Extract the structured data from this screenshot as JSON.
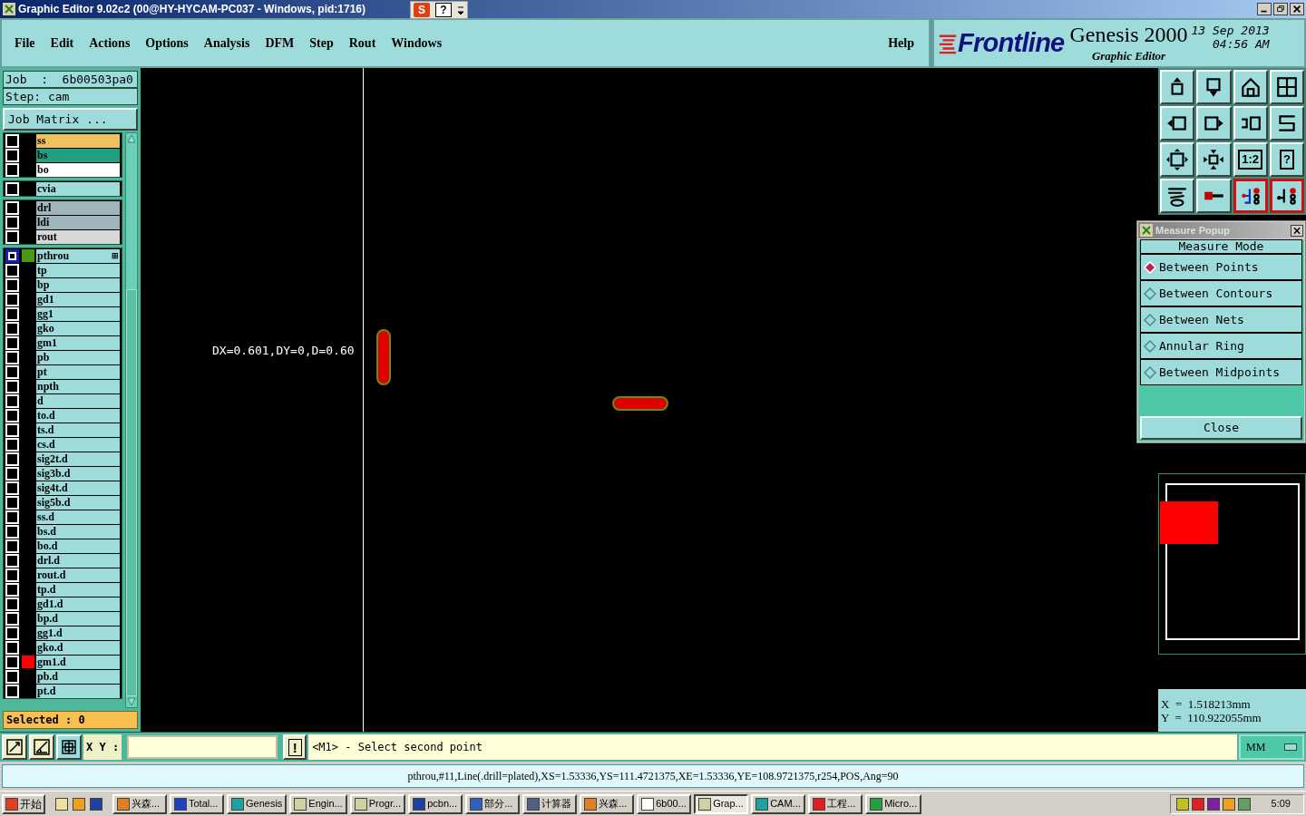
{
  "window": {
    "title": "Graphic Editor 9.02c2 (00@HY-HYCAM-PC037 - Windows, pid:1716)",
    "ime_buttons": [
      {
        "kind": "s",
        "label": "S"
      },
      {
        "kind": "help",
        "label": "?"
      }
    ]
  },
  "menu": [
    {
      "label": "File"
    },
    {
      "label": "Edit"
    },
    {
      "label": "Actions"
    },
    {
      "label": "Options"
    },
    {
      "label": "Analysis"
    },
    {
      "label": "DFM"
    },
    {
      "label": "Step"
    },
    {
      "label": "Rout"
    },
    {
      "label": "Windows"
    }
  ],
  "help_menu": "Help",
  "brand": {
    "logo": "Frontline",
    "product": "Genesis 2000",
    "subtitle": "Graphic Editor",
    "date": "13 Sep 2013",
    "time": "04:56 AM"
  },
  "job": {
    "job_label": "Job  :  6b00503pa0",
    "step_label": "Step: cam",
    "matrix_button": "Job Matrix ..."
  },
  "layer_groups": [
    {
      "layers": [
        {
          "name": "ss",
          "color": "#f0c060",
          "selected": false
        },
        {
          "name": "bs",
          "color": "#20a080",
          "selected": false
        },
        {
          "name": "bo",
          "color": "#ffffff",
          "selected": false
        }
      ]
    },
    {
      "layers": [
        {
          "name": "cvia",
          "color": "#9edcdc",
          "selected": false
        }
      ]
    },
    {
      "layers": [
        {
          "name": "drl",
          "color": "#a0b4bc",
          "selected": false
        },
        {
          "name": "ldi",
          "color": "#a0b4bc",
          "selected": false
        },
        {
          "name": "rout",
          "color": "#d8d8d8",
          "selected": false
        }
      ]
    },
    {
      "layers": [
        {
          "name": "pthrou",
          "color": "#9edcdc",
          "selected": true,
          "swatch": {
            "color": "#4a9a10"
          },
          "expand": "⊞"
        },
        {
          "name": "tp",
          "color": "#9edcdc",
          "selected": false
        },
        {
          "name": "bp",
          "color": "#9edcdc",
          "selected": false
        },
        {
          "name": "gd1",
          "color": "#9edcdc",
          "selected": false
        },
        {
          "name": "gg1",
          "color": "#9edcdc",
          "selected": false
        },
        {
          "name": "gko",
          "color": "#9edcdc",
          "selected": false
        },
        {
          "name": "gm1",
          "color": "#9edcdc",
          "selected": false
        },
        {
          "name": "pb",
          "color": "#9edcdc",
          "selected": false
        },
        {
          "name": "pt",
          "color": "#9edcdc",
          "selected": false
        },
        {
          "name": "npth",
          "color": "#9edcdc",
          "selected": false
        },
        {
          "name": "d",
          "color": "#9edcdc",
          "selected": false
        },
        {
          "name": "to.d",
          "color": "#9edcdc",
          "selected": false
        },
        {
          "name": "ts.d",
          "color": "#9edcdc",
          "selected": false
        },
        {
          "name": "cs.d",
          "color": "#9edcdc",
          "selected": false
        },
        {
          "name": "sig2t.d",
          "color": "#9edcdc",
          "selected": false
        },
        {
          "name": "sig3b.d",
          "color": "#9edcdc",
          "selected": false
        },
        {
          "name": "sig4t.d",
          "color": "#9edcdc",
          "selected": false
        },
        {
          "name": "sig5b.d",
          "color": "#9edcdc",
          "selected": false
        },
        {
          "name": "ss.d",
          "color": "#9edcdc",
          "selected": false
        },
        {
          "name": "bs.d",
          "color": "#9edcdc",
          "selected": false
        },
        {
          "name": "bo.d",
          "color": "#9edcdc",
          "selected": false
        },
        {
          "name": "drl.d",
          "color": "#9edcdc",
          "selected": false
        },
        {
          "name": "rout.d",
          "color": "#9edcdc",
          "selected": false
        },
        {
          "name": "tp.d",
          "color": "#9edcdc",
          "selected": false
        },
        {
          "name": "gd1.d",
          "color": "#9edcdc",
          "selected": false
        },
        {
          "name": "bp.d",
          "color": "#9edcdc",
          "selected": false
        },
        {
          "name": "gg1.d",
          "color": "#9edcdc",
          "selected": false
        },
        {
          "name": "gko.d",
          "color": "#9edcdc",
          "selected": false
        },
        {
          "name": "gm1.d",
          "color": "#9edcdc",
          "selected": false,
          "swatch": {
            "color": "#ff0000"
          }
        },
        {
          "name": "pb.d",
          "color": "#9edcdc",
          "selected": false
        },
        {
          "name": "pt.d",
          "color": "#9edcdc",
          "selected": false
        }
      ]
    }
  ],
  "selected_count": "Selected : 0",
  "canvas": {
    "measure_text": "DX=0.601,DY=0,D=0.60"
  },
  "toolbar": [
    {
      "kind": "up",
      "on": false
    },
    {
      "kind": "down",
      "on": false
    },
    {
      "kind": "home",
      "on": false
    },
    {
      "kind": "window",
      "on": false
    },
    {
      "kind": "left",
      "on": false
    },
    {
      "kind": "right",
      "on": false
    },
    {
      "kind": "undo",
      "on": false
    },
    {
      "kind": "route",
      "on": false
    },
    {
      "kind": "fit",
      "on": false
    },
    {
      "kind": "center",
      "on": false
    },
    {
      "kind": "text",
      "label": "1:2",
      "on": false
    },
    {
      "kind": "text",
      "label": "?",
      "on": false
    },
    {
      "kind": "tools",
      "on": false
    },
    {
      "kind": "pad",
      "on": false
    },
    {
      "kind": "circuit",
      "on": true
    },
    {
      "kind": "circuit2",
      "on": true
    }
  ],
  "measure_popup": {
    "title": "Measure Popup",
    "heading": "Measure Mode",
    "modes": [
      {
        "label": "Between Points",
        "selected": true
      },
      {
        "label": "Between Contours",
        "selected": false
      },
      {
        "label": "Between Nets",
        "selected": false
      },
      {
        "label": "Annular Ring",
        "selected": false
      },
      {
        "label": "Between Midpoints",
        "selected": false
      }
    ],
    "close_button": "Close"
  },
  "coordinates": {
    "x": "X  =  1.518213mm",
    "y": "Y  =  110.922055mm"
  },
  "command_bar": {
    "xy_label": "X Y :",
    "alert_button": "!",
    "message": "<M1> - Select second point",
    "units": "MM"
  },
  "status_bar": "pthrou,#11,Line(.drill=plated),XS=1.53336,YS=111.4721375,XE=1.53336,YE=108.9721375,r254,POS,Ang=90",
  "taskbar": {
    "start": "开始",
    "tasks": [
      {
        "label": "兴森...",
        "selected": false
      },
      {
        "label": "Total...",
        "selected": false
      },
      {
        "label": "Genesis",
        "selected": false
      },
      {
        "label": "Engin...",
        "selected": false
      },
      {
        "label": "Progr...",
        "selected": false
      },
      {
        "label": "pcbn...",
        "selected": false
      },
      {
        "label": "部分...",
        "selected": false
      },
      {
        "label": "计算器",
        "selected": false
      },
      {
        "label": "兴森...",
        "selected": false
      },
      {
        "label": "6b00...",
        "selected": false
      },
      {
        "label": "Grap...",
        "selected": true
      },
      {
        "label": "CAM...",
        "selected": false
      },
      {
        "label": "工程...",
        "selected": false
      },
      {
        "label": "Micro...",
        "selected": false
      }
    ],
    "clock": "5:09"
  }
}
